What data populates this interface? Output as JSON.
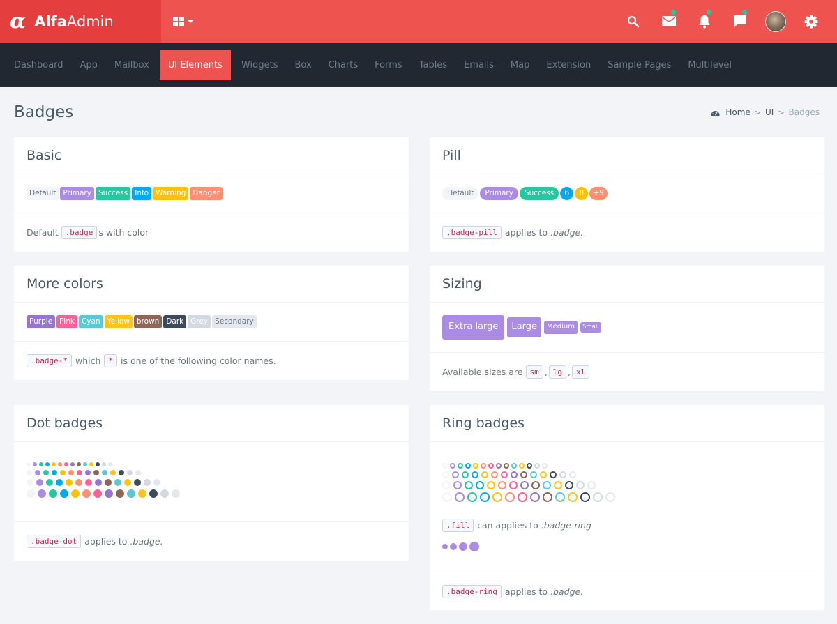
{
  "brand": {
    "logo_glyph": "α",
    "name_bold": "Alfa",
    "name_light": "Admin"
  },
  "topbar": {
    "icons": [
      {
        "name": "search-icon",
        "has_dot": false
      },
      {
        "name": "mail-icon",
        "has_dot": true
      },
      {
        "name": "bell-icon",
        "has_dot": true
      },
      {
        "name": "chat-icon",
        "has_dot": true
      },
      {
        "name": "avatar",
        "has_dot": false
      },
      {
        "name": "gear-icon",
        "has_dot": false
      }
    ],
    "notification_dot_color": "#26c6a0"
  },
  "nav": {
    "items": [
      "Dashboard",
      "App",
      "Mailbox",
      "UI Elements",
      "Widgets",
      "Box",
      "Charts",
      "Forms",
      "Tables",
      "Emails",
      "Map",
      "Extension",
      "Sample Pages",
      "Multilevel"
    ],
    "active": "UI Elements"
  },
  "page": {
    "title": "Badges",
    "breadcrumb": {
      "home": "Home",
      "section": "UI",
      "current": "Badges",
      "separator": ">"
    }
  },
  "colors": {
    "default": "#f3f4f8",
    "primary": "#ab8ce4",
    "success": "#26c6a0",
    "info": "#03a9f3",
    "warning": "#ffc107",
    "danger": "#ff8f70",
    "pink": "#f96197",
    "purple": "#9675ce",
    "cyan": "#5bc8d6",
    "yellow": "#ffc31c",
    "brown": "#8d6658",
    "dark": "#3e4a5b",
    "grey": "#d3d8e2",
    "secondary": "#e4e7ed"
  },
  "cards": {
    "basic": {
      "title": "Basic",
      "badges": [
        "Default",
        "Primary",
        "Success",
        "Info",
        "Warning",
        "Danger"
      ],
      "footer_pre": "Default",
      "footer_code": ".badge",
      "footer_post": "s with color"
    },
    "pill": {
      "title": "Pill",
      "badges": [
        "Default",
        "Primary",
        "Success",
        "6",
        "8",
        "+9"
      ],
      "footer_code": ".badge-pill",
      "footer_post": "applies to",
      "footer_em": ".badge."
    },
    "more_colors": {
      "title": "More colors",
      "badges": [
        "Purple",
        "Pink",
        "Cyan",
        "Yellow",
        "brown",
        "Dark",
        "Grey",
        "Secondary"
      ],
      "footer_code1": ".badge-*",
      "footer_mid": "which",
      "footer_code2": "*",
      "footer_post": "is one of the following color names."
    },
    "sizing": {
      "title": "Sizing",
      "badges": [
        "Extra large",
        "Large",
        "Medium",
        "Small"
      ],
      "footer_pre": "Available sizes are",
      "codes": [
        "sm",
        "lg",
        "xl"
      ],
      "comma": ","
    },
    "dot": {
      "title": "Dot badges",
      "footer_code": ".badge-dot",
      "footer_post": "applies to",
      "footer_em": ".badge."
    },
    "ring": {
      "title": "Ring badges",
      "fill_code": ".fill",
      "fill_post": "can applies to",
      "fill_em": ".badge-ring",
      "footer_code": ".badge-ring",
      "footer_post": "applies to",
      "footer_em": ".badge."
    }
  }
}
